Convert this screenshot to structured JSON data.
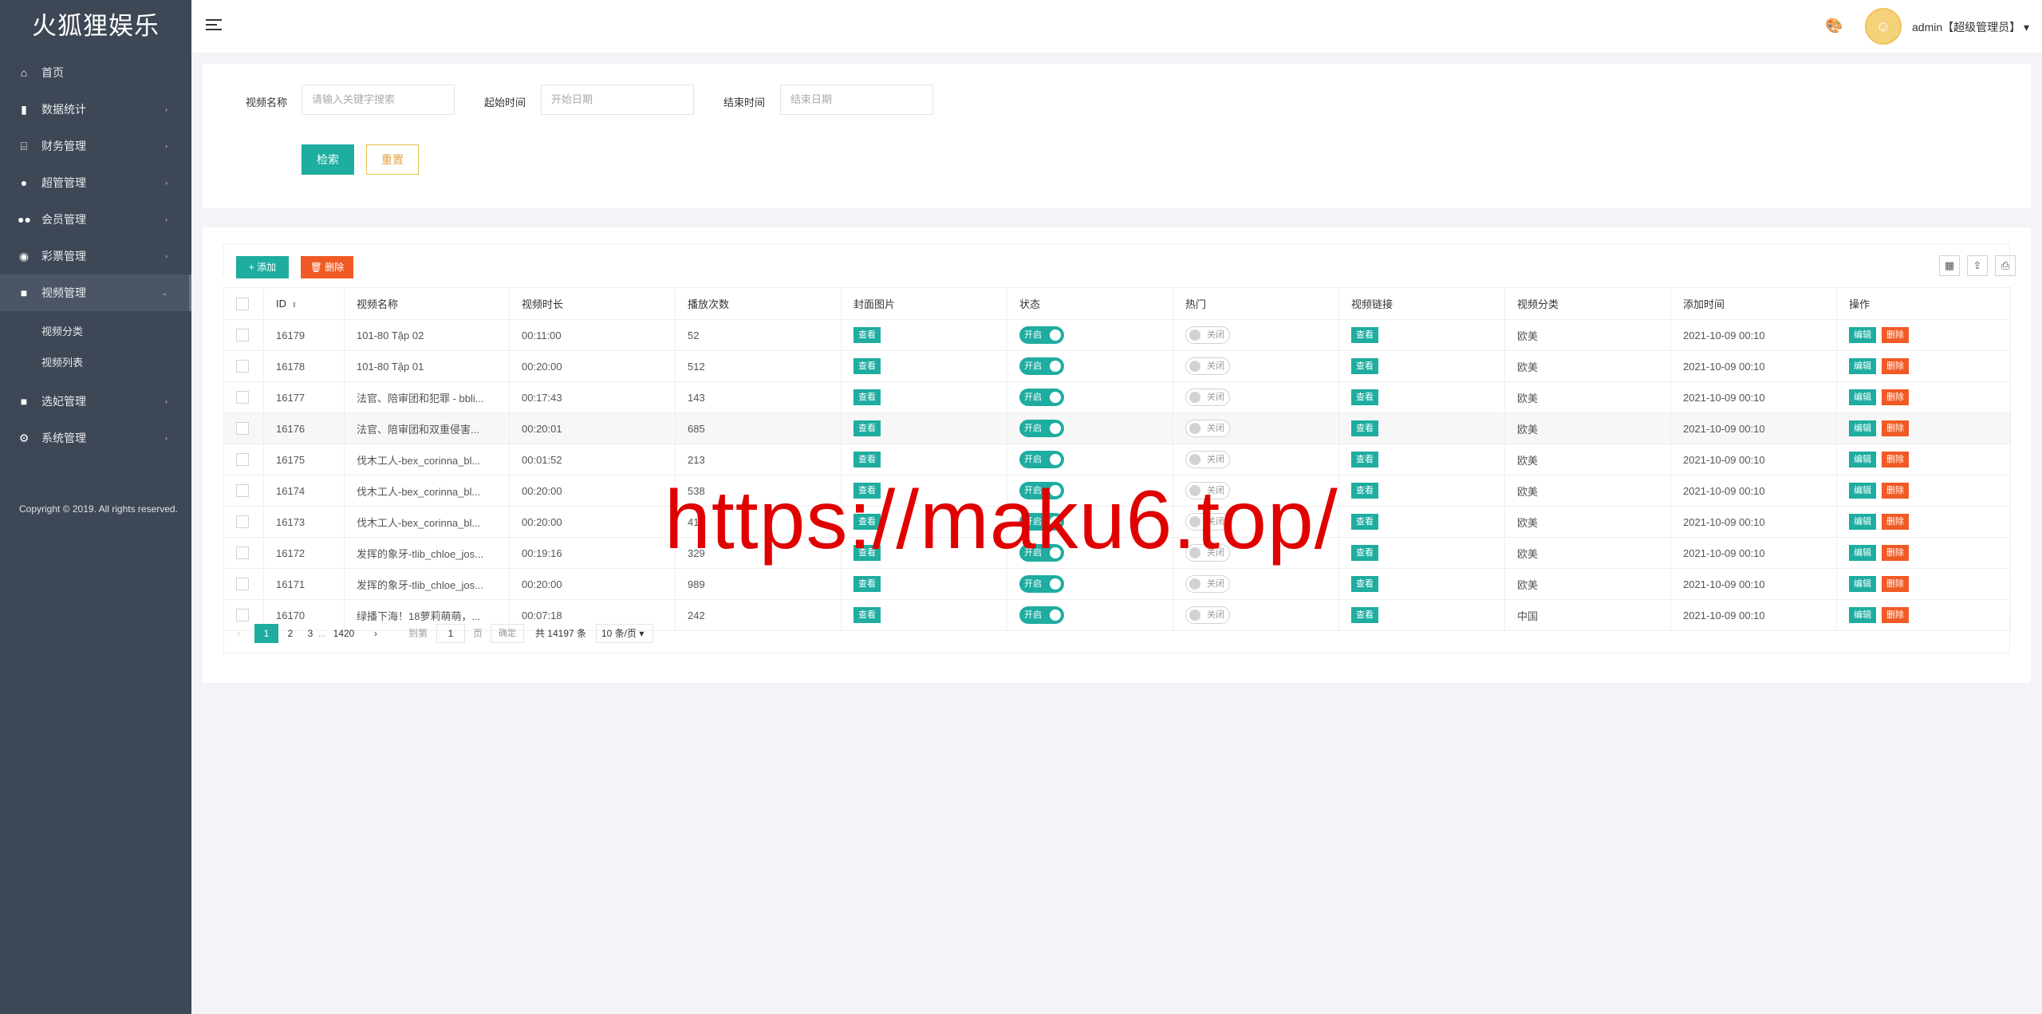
{
  "sidebar": {
    "logo": "火狐狸娱乐",
    "items": [
      {
        "label": "首页",
        "icon": "⌂",
        "arrow": ""
      },
      {
        "label": "数据统计",
        "icon": "▮",
        "arrow": "›"
      },
      {
        "label": "财务管理",
        "icon": "⌸",
        "arrow": "›"
      },
      {
        "label": "超管管理",
        "icon": "●",
        "arrow": "›"
      },
      {
        "label": "会员管理",
        "icon": "●●",
        "arrow": "›"
      },
      {
        "label": "彩票管理",
        "icon": "◉",
        "arrow": "›"
      },
      {
        "label": "视频管理",
        "icon": "■",
        "arrow": "⌄"
      },
      {
        "label": "选妃管理",
        "icon": "■",
        "arrow": "›"
      },
      {
        "label": "系统管理",
        "icon": "⚙",
        "arrow": "›"
      }
    ],
    "sub_items": [
      "视频分类",
      "视频列表"
    ],
    "copyright": "Copyright © 2019. All rights reserved."
  },
  "header": {
    "user": "admin【超级管理员】 ▾"
  },
  "search": {
    "name_label": "视频名称",
    "name_placeholder": "请输入关键字搜索",
    "start_label": "起始时间",
    "start_placeholder": "开始日期",
    "end_label": "结束时间",
    "end_placeholder": "结束日期",
    "search_btn": "检索",
    "reset_btn": "重置"
  },
  "toolbar": {
    "add": "+ 添加",
    "delete": "🗑 删除"
  },
  "table": {
    "headers": [
      "ID",
      "视频名称",
      "视频时长",
      "播放次数",
      "封面图片",
      "状态",
      "热门",
      "视频链接",
      "视频分类",
      "添加时间",
      "操作"
    ],
    "view_label": "查看",
    "on_label": "开启",
    "off_label": "关闭",
    "edit_label": "编辑",
    "remove_label": "删除",
    "rows": [
      {
        "id": "16179",
        "name": "101-80 Tập 02",
        "duration": "00:11:00",
        "plays": "52",
        "category": "欧美",
        "time": "2021-10-09 00:10"
      },
      {
        "id": "16178",
        "name": "101-80 Tập 01",
        "duration": "00:20:00",
        "plays": "512",
        "category": "欧美",
        "time": "2021-10-09 00:10"
      },
      {
        "id": "16177",
        "name": "法官、陪审团和犯罪 - bbli...",
        "duration": "00:17:43",
        "plays": "143",
        "category": "欧美",
        "time": "2021-10-09 00:10"
      },
      {
        "id": "16176",
        "name": "法官、陪审团和双重侵害...",
        "duration": "00:20:01",
        "plays": "685",
        "category": "欧美",
        "time": "2021-10-09 00:10"
      },
      {
        "id": "16175",
        "name": "伐木工人-bex_corinna_bl...",
        "duration": "00:01:52",
        "plays": "213",
        "category": "欧美",
        "time": "2021-10-09 00:10"
      },
      {
        "id": "16174",
        "name": "伐木工人-bex_corinna_bl...",
        "duration": "00:20:00",
        "plays": "538",
        "category": "欧美",
        "time": "2021-10-09 00:10"
      },
      {
        "id": "16173",
        "name": "伐木工人-bex_corinna_bl...",
        "duration": "00:20:00",
        "plays": "411",
        "category": "欧美",
        "time": "2021-10-09 00:10"
      },
      {
        "id": "16172",
        "name": "发挥的象牙-tlib_chloe_jos...",
        "duration": "00:19:16",
        "plays": "329",
        "category": "欧美",
        "time": "2021-10-09 00:10"
      },
      {
        "id": "16171",
        "name": "发挥的象牙-tlib_chloe_jos...",
        "duration": "00:20:00",
        "plays": "989",
        "category": "欧美",
        "time": "2021-10-09 00:10"
      },
      {
        "id": "16170",
        "name": "绿播下海！18萝莉萌萌，...",
        "duration": "00:07:18",
        "plays": "242",
        "category": "中国",
        "time": "2021-10-09 00:10"
      }
    ]
  },
  "pager": {
    "prev": "‹",
    "p1": "1",
    "p2": "2",
    "p3": "3",
    "ellipsis": "...",
    "last": "1420",
    "next": "›",
    "goto_label": "到第",
    "goto_value": "1",
    "page_unit": "页",
    "confirm": "确定",
    "total": "共 14197 条",
    "per_page": "10 条/页 ▾"
  },
  "watermark": "https://maku6.top/",
  "colors": {
    "sidebar": "#3e4755",
    "accent": "#1eada0",
    "danger": "#f05a24",
    "background": "#f3f4f8"
  }
}
